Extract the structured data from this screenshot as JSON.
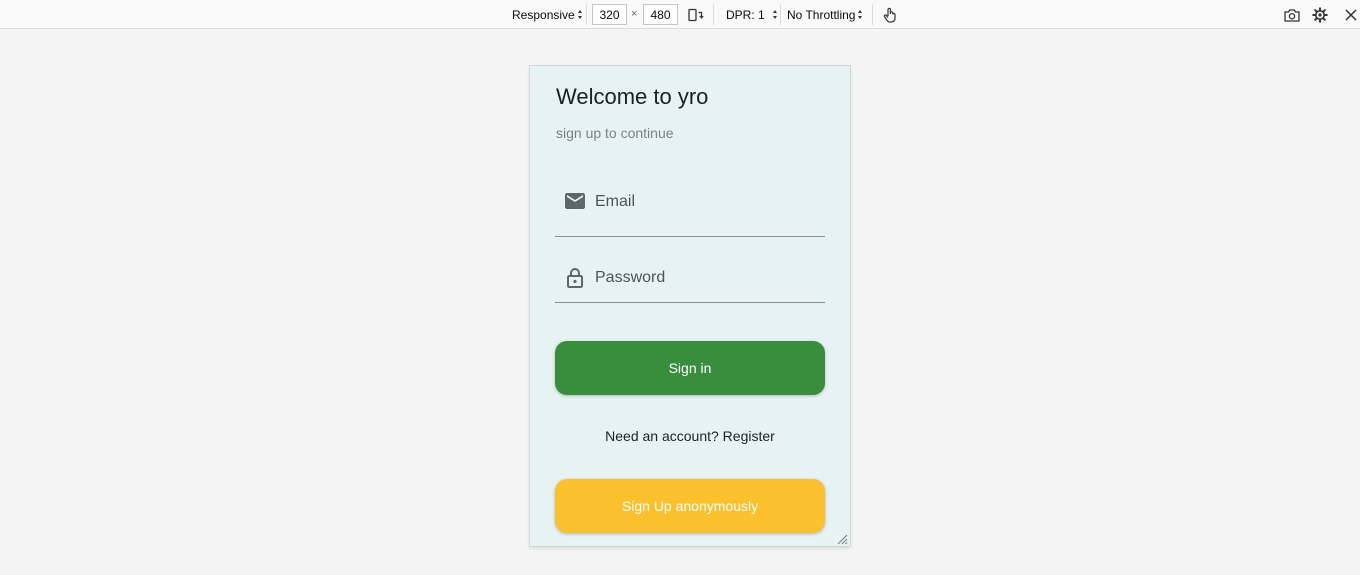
{
  "toolbar": {
    "device": "Responsive",
    "width": "320",
    "times": "×",
    "height": "480",
    "dpr": "DPR: 1",
    "throttling": "No Throttling",
    "icons": [
      "rotate-icon",
      "touch-icon",
      "screenshot-icon",
      "settings-icon",
      "close-icon"
    ]
  },
  "app": {
    "title": "Welcome to yro",
    "subtitle": "sign up to continue",
    "email_label": "Email",
    "password_label": "Password",
    "signin_label": "Sign in",
    "register_text": "Need an account? Register",
    "anon_label": "Sign Up anonymously",
    "colors": {
      "background": "#e7f3f3",
      "primary": "#388e3c",
      "accent": "#fbc02d"
    }
  }
}
